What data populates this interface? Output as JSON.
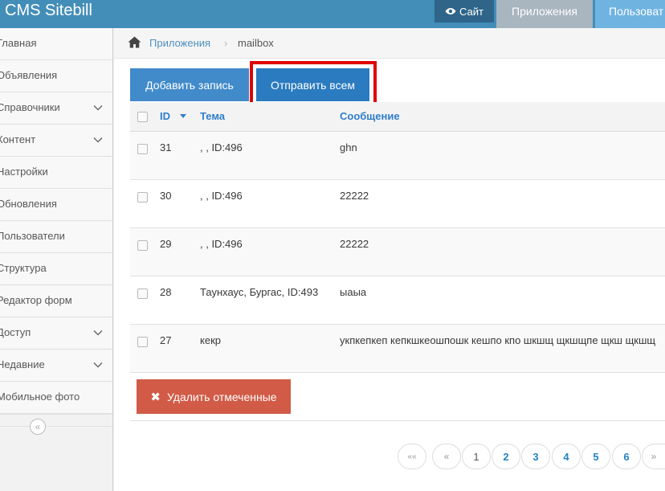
{
  "navbar": {
    "brand": "CMS Sitebill",
    "site_label": "Сайт",
    "apps_label": "Приложения",
    "users_label": "Пользоват"
  },
  "sidebar": {
    "items": [
      {
        "label": "Главная",
        "has_submenu": false
      },
      {
        "label": "Объявления",
        "has_submenu": false
      },
      {
        "label": "Справочники",
        "has_submenu": true
      },
      {
        "label": "Контент",
        "has_submenu": true
      },
      {
        "label": "Настройки",
        "has_submenu": false
      },
      {
        "label": "Обновления",
        "has_submenu": false
      },
      {
        "label": "Пользователи",
        "has_submenu": false
      },
      {
        "label": "Структура",
        "has_submenu": false
      },
      {
        "label": "Редактор форм",
        "has_submenu": false
      },
      {
        "label": "Доступ",
        "has_submenu": true
      },
      {
        "label": "Недавние",
        "has_submenu": true
      },
      {
        "label": "Мобильное фото",
        "has_submenu": false
      }
    ],
    "collapse_glyph": "«"
  },
  "breadcrumb": {
    "apps": "Приложения",
    "separator": "›",
    "current": "mailbox"
  },
  "toolbar": {
    "add_label": "Добавить запись",
    "send_all_label": "Отправить всем"
  },
  "table": {
    "headers": {
      "id": "ID",
      "subject": "Тема",
      "message": "Сообщение"
    },
    "rows": [
      {
        "id": "31",
        "subject": ", , ID:496",
        "message": "ghn"
      },
      {
        "id": "30",
        "subject": ", , ID:496",
        "message": "22222"
      },
      {
        "id": "29",
        "subject": ", , ID:496",
        "message": "22222"
      },
      {
        "id": "28",
        "subject": "Таунхаус, Бургас, ID:493",
        "message": "ыаыа"
      },
      {
        "id": "27",
        "subject": "кекр",
        "message": "укпкепкеп кепкшкеошпошк кешпо кпо шкшщ щкшщпе щкш щкшщ"
      }
    ]
  },
  "delete_label": "Удалить отмеченные",
  "pagination": {
    "first": "««",
    "prev": "«",
    "pages": [
      "1",
      "2",
      "3",
      "4",
      "5",
      "6"
    ],
    "next": "»",
    "current_page": "1"
  },
  "colors": {
    "navbar": "#438eb9",
    "primary": "#428bca",
    "danger": "#d15b47",
    "highlight_frame": "#e00000"
  }
}
